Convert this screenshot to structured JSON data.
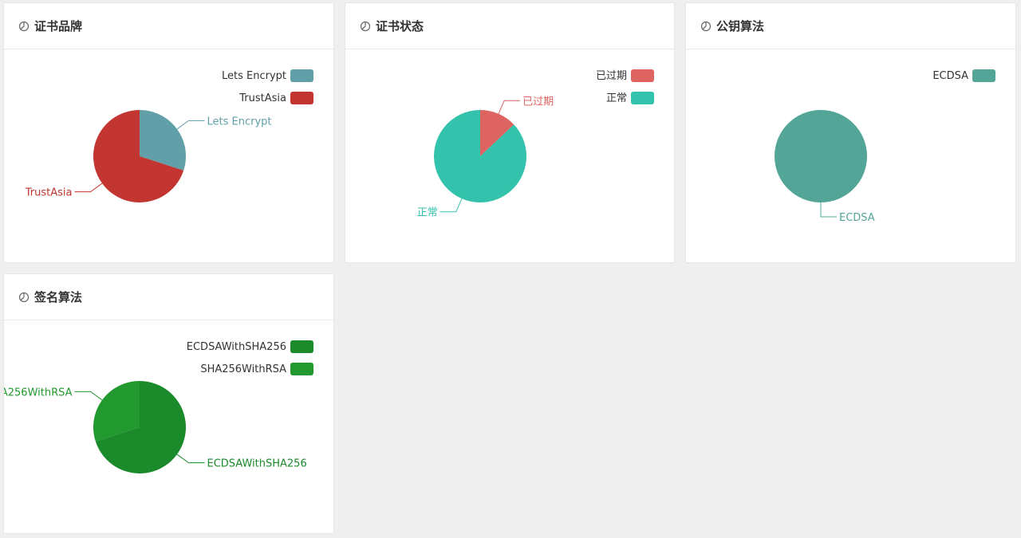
{
  "cards": [
    {
      "title": "证书品牌",
      "chart_data": {
        "type": "pie",
        "categories": [
          "Lets Encrypt",
          "TrustAsia"
        ],
        "values": [
          30,
          70
        ],
        "colors": [
          "#61a0a8",
          "#c23531"
        ],
        "legend_position": "top-right"
      }
    },
    {
      "title": "证书状态",
      "chart_data": {
        "type": "pie",
        "categories": [
          "已过期",
          "正常"
        ],
        "values": [
          13,
          87
        ],
        "colors": [
          "#dd6461",
          "#33c2ab"
        ],
        "legend_position": "top-right"
      }
    },
    {
      "title": "公钥算法",
      "chart_data": {
        "type": "pie",
        "categories": [
          "ECDSA"
        ],
        "values": [
          100
        ],
        "colors": [
          "#52a597"
        ],
        "legend_position": "top-right"
      }
    },
    {
      "title": "签名算法",
      "chart_data": {
        "type": "pie",
        "categories": [
          "ECDSAWithSHA256",
          "SHA256WithRSA"
        ],
        "values": [
          70,
          30
        ],
        "colors": [
          "#1a8a2a",
          "#21992f"
        ],
        "legend_position": "top-right"
      }
    }
  ]
}
